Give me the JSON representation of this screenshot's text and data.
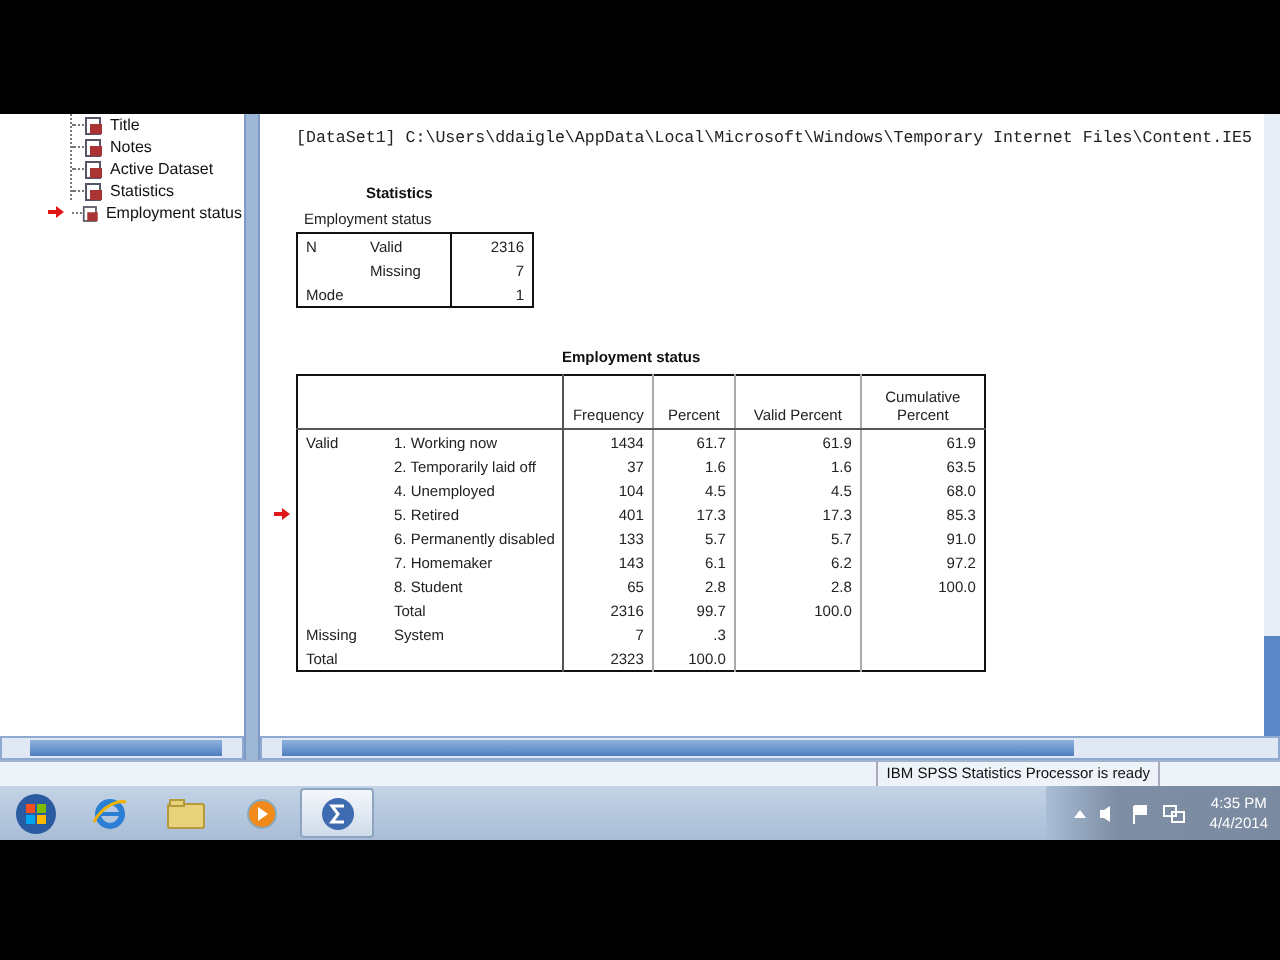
{
  "navigator": {
    "items": [
      {
        "label": "Title",
        "selected": false
      },
      {
        "label": "Notes",
        "selected": false
      },
      {
        "label": "Active Dataset",
        "selected": false
      },
      {
        "label": "Statistics",
        "selected": false
      },
      {
        "label": "Employment status",
        "selected": true
      }
    ]
  },
  "output": {
    "log": "[DataSet1] C:\\Users\\ddaigle\\AppData\\Local\\Microsoft\\Windows\\Temporary Internet Files\\Content.IE5",
    "statistics": {
      "title": "Statistics",
      "subtitle": "Employment status",
      "rows": [
        {
          "label": "N",
          "sublabel": "Valid",
          "value": "2316"
        },
        {
          "sublabel": "Missing",
          "value": "7"
        },
        {
          "label": "Mode",
          "value": "1"
        }
      ]
    },
    "frequency_table": {
      "title": "Employment status",
      "columns": [
        "Frequency",
        "Percent",
        "Valid Percent",
        "Cumulative Percent"
      ],
      "rows": [
        {
          "group": "Valid",
          "label": "1. Working now",
          "frequency": "1434",
          "percent": "61.7",
          "valid_percent": "61.9",
          "cumulative_percent": "61.9",
          "selected": false
        },
        {
          "label": "2. Temporarily laid off",
          "frequency": "37",
          "percent": "1.6",
          "valid_percent": "1.6",
          "cumulative_percent": "63.5",
          "selected": false
        },
        {
          "label": "4. Unemployed",
          "frequency": "104",
          "percent": "4.5",
          "valid_percent": "4.5",
          "cumulative_percent": "68.0",
          "selected": false
        },
        {
          "label": "5. Retired",
          "frequency": "401",
          "percent": "17.3",
          "valid_percent": "17.3",
          "cumulative_percent": "85.3",
          "selected": true
        },
        {
          "label": "6. Permanently disabled",
          "frequency": "133",
          "percent": "5.7",
          "valid_percent": "5.7",
          "cumulative_percent": "91.0",
          "selected": false
        },
        {
          "label": "7. Homemaker",
          "frequency": "143",
          "percent": "6.1",
          "valid_percent": "6.2",
          "cumulative_percent": "97.2",
          "selected": false
        },
        {
          "label": "8. Student",
          "frequency": "65",
          "percent": "2.8",
          "valid_percent": "2.8",
          "cumulative_percent": "100.0",
          "selected": false
        },
        {
          "label": "Total",
          "frequency": "2316",
          "percent": "99.7",
          "valid_percent": "100.0",
          "selected": false
        },
        {
          "group": "Missing",
          "label": "System",
          "frequency": "7",
          "percent": ".3",
          "selected": false
        },
        {
          "group": "Total",
          "frequency": "2323",
          "percent": "100.0",
          "selected": false
        }
      ]
    }
  },
  "status_bar": {
    "message": "IBM SPSS Statistics Processor is ready"
  },
  "taskbar": {
    "apps": [
      {
        "kind": "browser",
        "selected": false
      },
      {
        "kind": "folder",
        "selected": false
      },
      {
        "kind": "media",
        "selected": false
      },
      {
        "kind": "statistics",
        "selected": true
      }
    ],
    "clock": {
      "time": "4:35 PM",
      "date": "4/4/2014"
    }
  }
}
